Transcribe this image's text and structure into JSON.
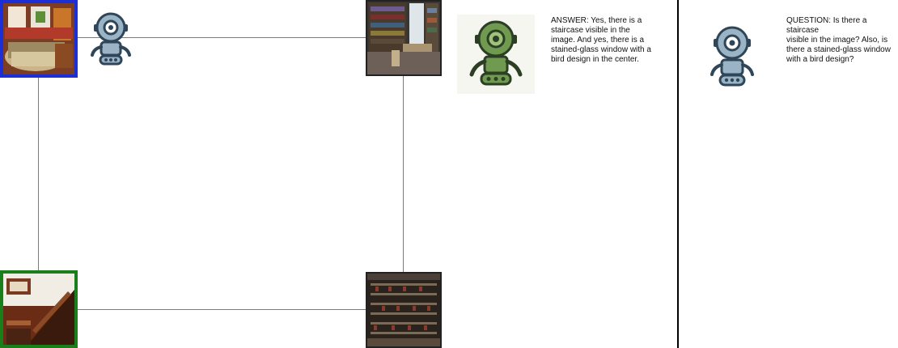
{
  "answer": {
    "text": "ANSWER: Yes, there is a\nstaircase visible in the\nimage. And yes, there is a\nstained-glass window with a\nbird design in the center."
  },
  "question": {
    "text": "QUESTION: Is there a staircase\nvisible in the image? Also, is\nthere a stained-glass window\nwith a bird design?"
  },
  "nodes": [
    {
      "name": "living-room",
      "selected": "blue"
    },
    {
      "name": "library",
      "selected": "none"
    },
    {
      "name": "staircase",
      "selected": "green"
    },
    {
      "name": "wine-cellar",
      "selected": "none"
    }
  ],
  "colors": {
    "blue_frame": "#1c2fd6",
    "green_frame": "#1a7f1a",
    "robot_blue": "#9ab4c6",
    "robot_green": "#6f9a4f"
  },
  "icons": [
    "robot-icon-blue",
    "robot-icon-green",
    "robot-icon-blue"
  ]
}
